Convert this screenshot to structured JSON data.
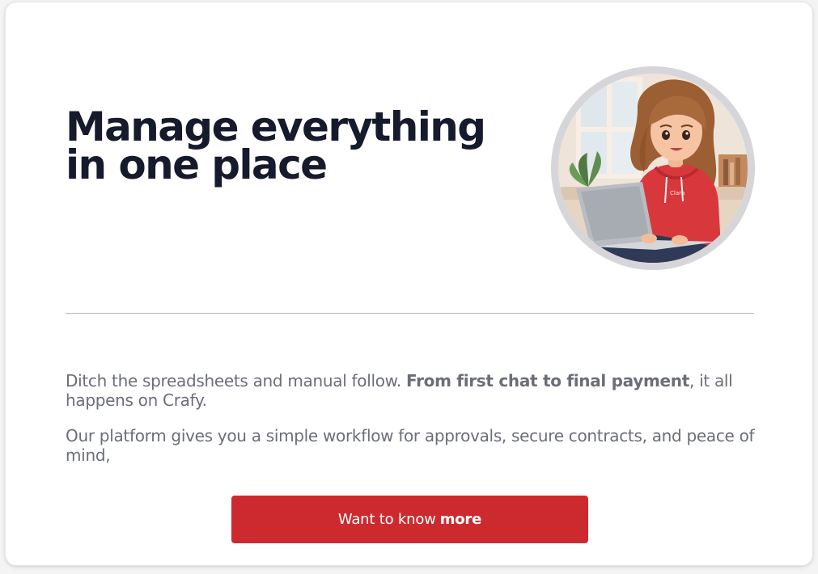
{
  "hero": {
    "headline": "Manage everything in one place",
    "avatar_alt": "Illustrated woman in a red hoodie using a laptop",
    "avatar_hoodie_text": "Clara"
  },
  "body": {
    "para1_regular": "Ditch the spreadsheets and manual follow. ",
    "para1_bold": "From first chat to final payment",
    "para1_tail": ", it all happens on Crafy.",
    "para2": "Our platform gives you a simple workflow for approvals, secure contracts, and peace of mind,"
  },
  "cta": {
    "label_regular": "Want to know",
    "label_bold": "more"
  },
  "colors": {
    "accent": "#cd2a30",
    "headline": "#151b2c",
    "body_text": "#6b6e78",
    "divider": "#b9b9bd"
  }
}
